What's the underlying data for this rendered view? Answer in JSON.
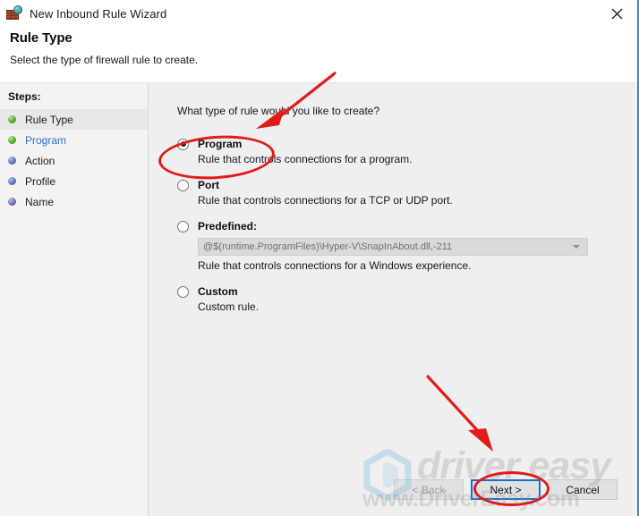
{
  "window": {
    "title": "New Inbound Rule Wizard",
    "icon": "firewall-globe-icon",
    "close_label": "✕"
  },
  "header": {
    "title": "Rule Type",
    "subtitle": "Select the type of firewall rule to create."
  },
  "sidebar": {
    "label": "Steps:",
    "items": [
      {
        "label": "Rule Type",
        "dot": "green",
        "state": "current"
      },
      {
        "label": "Program",
        "dot": "green",
        "state": "link"
      },
      {
        "label": "Action",
        "dot": "blue",
        "state": "pending"
      },
      {
        "label": "Profile",
        "dot": "blue",
        "state": "pending"
      },
      {
        "label": "Name",
        "dot": "blue",
        "state": "pending"
      }
    ]
  },
  "main": {
    "prompt": "What type of rule would you like to create?",
    "options": [
      {
        "title": "Program",
        "description": "Rule that controls connections for a program.",
        "selected": true
      },
      {
        "title": "Port",
        "description": "Rule that controls connections for a TCP or UDP port.",
        "selected": false
      },
      {
        "title": "Predefined:",
        "description": "Rule that controls connections for a Windows experience.",
        "selected": false,
        "combo_value": "@$(runtime.ProgramFiles)\\Hyper-V\\SnapInAbout.dll,-211"
      },
      {
        "title": "Custom",
        "description": "Custom rule.",
        "selected": false
      }
    ]
  },
  "footer": {
    "back_label": "< Back",
    "next_label": "Next >",
    "cancel_label": "Cancel"
  },
  "watermark": {
    "brand": "driver easy",
    "url": "www.DriverEasy.com"
  },
  "colors": {
    "accent_blue": "#1a6fc4",
    "annotation_red": "#e01b1b",
    "link_blue": "#2c6fc4",
    "panel_gray": "#efefef",
    "sidebar_gray": "#f3f3f3"
  }
}
